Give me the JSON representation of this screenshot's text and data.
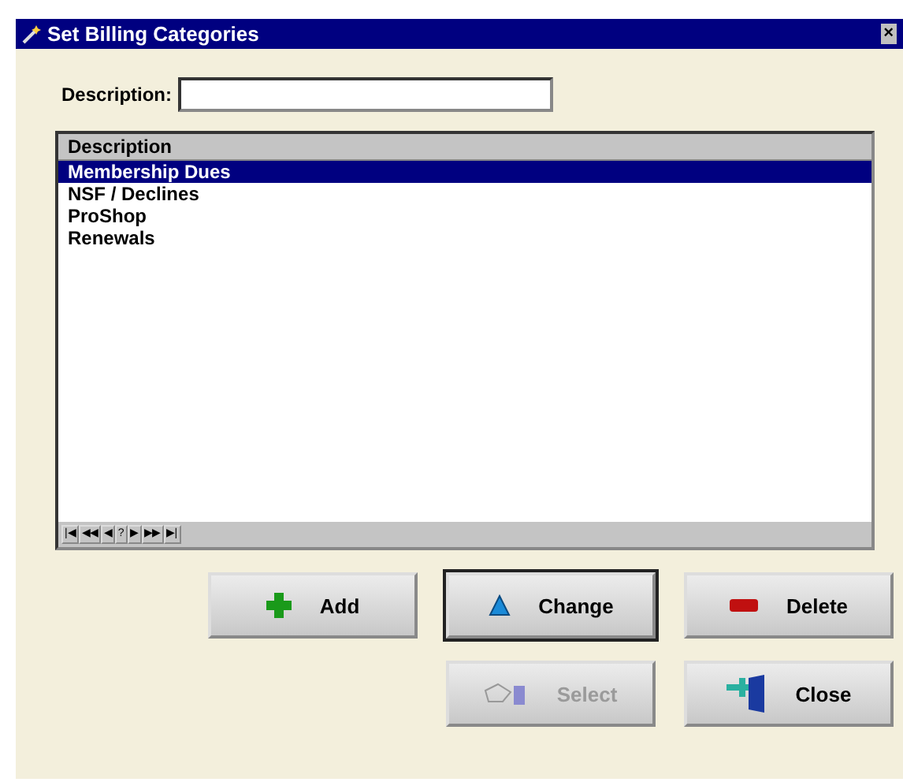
{
  "window": {
    "title": "Set Billing Categories",
    "close": "×"
  },
  "description_field": {
    "label": "Description:"
  },
  "list": {
    "column": "Description",
    "rows": [
      {
        "text": "Membership Dues",
        "selected": true
      },
      {
        "text": "NSF / Declines",
        "selected": false
      },
      {
        "text": "ProShop",
        "selected": false
      },
      {
        "text": "Renewals",
        "selected": false
      }
    ],
    "navigator": [
      "|◀",
      "◀◀",
      "◀",
      "?",
      "▶",
      "▶▶",
      "▶|"
    ]
  },
  "buttons": [
    {
      "kind": "add",
      "label": "Add",
      "disabled": false,
      "focused": false
    },
    {
      "kind": "change",
      "label": "Change",
      "disabled": false,
      "focused": true
    },
    {
      "kind": "delete",
      "label": "Delete",
      "disabled": false,
      "focused": false
    },
    {
      "kind": "select",
      "label": "Select",
      "disabled": true,
      "focused": false
    },
    {
      "kind": "close",
      "label": "Close",
      "disabled": false,
      "focused": false
    }
  ]
}
